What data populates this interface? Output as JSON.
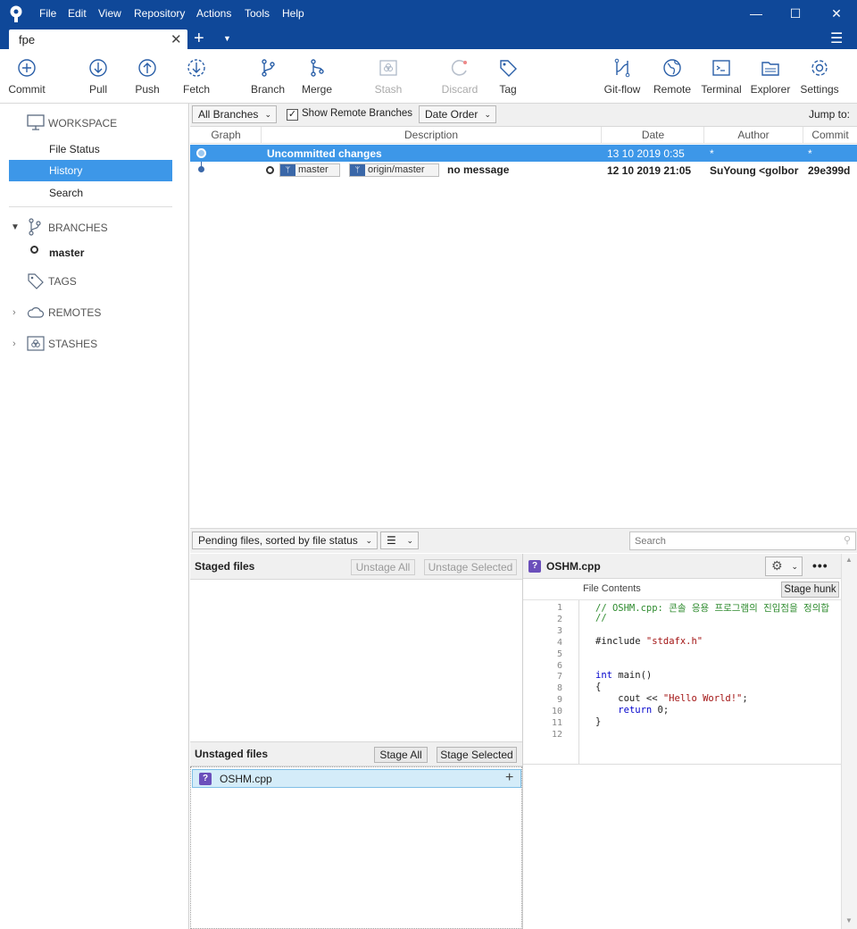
{
  "window": {
    "tab_name": "fpe"
  },
  "menu": [
    "File",
    "Edit",
    "View",
    "Repository",
    "Actions",
    "Tools",
    "Help"
  ],
  "toolbar": {
    "commit": "Commit",
    "pull": "Pull",
    "push": "Push",
    "fetch": "Fetch",
    "branch": "Branch",
    "merge": "Merge",
    "stash": "Stash",
    "discard": "Discard",
    "tag": "Tag",
    "gitflow": "Git-flow",
    "remote": "Remote",
    "terminal": "Terminal",
    "explorer": "Explorer",
    "settings": "Settings"
  },
  "sidebar": {
    "workspace": "WORKSPACE",
    "workspace_items": [
      "File Status",
      "History",
      "Search"
    ],
    "branches": "BRANCHES",
    "branch_items": [
      "master"
    ],
    "tags": "TAGS",
    "remotes": "REMOTES",
    "stashes": "STASHES"
  },
  "history": {
    "branch_filter": "All Branches",
    "show_remote": "Show Remote Branches",
    "order": "Date Order",
    "jump_to": "Jump to:",
    "columns": [
      "Graph",
      "Description",
      "Date",
      "Author",
      "Commit"
    ],
    "rows": [
      {
        "description": "Uncommitted changes",
        "date": "13 10 2019 0:35",
        "author": "*",
        "commit": "*"
      },
      {
        "description": "no message",
        "date": "12 10 2019 21:05",
        "author": "SuYoung <golbor",
        "commit": "29e399d",
        "branches": [
          "master",
          "origin/master"
        ]
      }
    ]
  },
  "files": {
    "sort_label": "Pending files, sorted by file status",
    "search_placeholder": "Search",
    "staged_title": "Staged files",
    "unstage_all": "Unstage All",
    "unstage_selected": "Unstage Selected",
    "unstaged_title": "Unstaged files",
    "stage_all": "Stage All",
    "stage_selected": "Stage Selected",
    "unstaged_items": [
      "OSHM.cpp"
    ]
  },
  "diff": {
    "file_name": "OSHM.cpp",
    "contents_label": "File Contents",
    "stage_hunk": "Stage hunk",
    "line_numbers": [
      "1",
      "2",
      "3",
      "4",
      "5",
      "6",
      "7",
      "8",
      "9",
      "10",
      "11",
      "12"
    ],
    "lines": [
      "// OSHM.cpp: 콘솔 응용 프로그램의 진입점을 정의합",
      "//",
      "",
      "#include \"stdafx.h\"",
      "",
      "",
      "int main()",
      "{",
      "    cout << \"Hello World!\";",
      "    return 0;",
      "}",
      ""
    ]
  },
  "colors": {
    "accent": "#0f4899",
    "selection": "#3d97e8",
    "sidebar_selected": "#3d97e8"
  }
}
